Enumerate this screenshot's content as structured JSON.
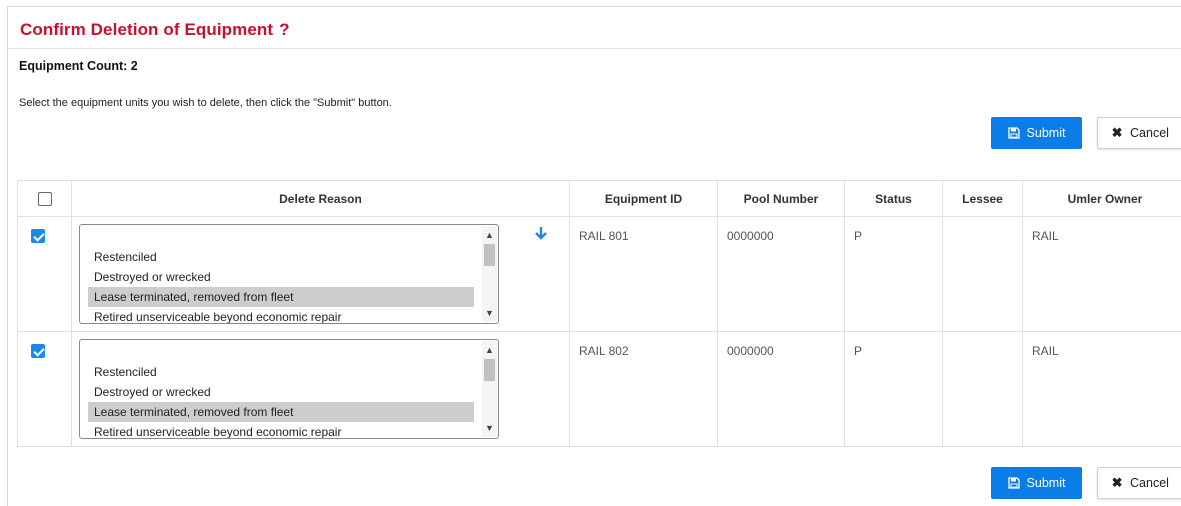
{
  "page": {
    "title": "Confirm Deletion of Equipment",
    "help_icon": "question-mark-icon",
    "count_text": "Equipment Count: 2",
    "instructions": "Select the equipment units you wish to delete, then click the \"Submit\" button."
  },
  "buttons": {
    "submit_label": "Submit",
    "cancel_label": "Cancel",
    "submit_icon": "floppy-disk-icon",
    "cancel_icon": "x-icon"
  },
  "colors": {
    "title": "#c8102e",
    "primary": "#0a7de8",
    "checkbox": "#1e88e5"
  },
  "table": {
    "headers": [
      "",
      "Delete Reason",
      "Equipment ID",
      "Pool Number",
      "Status",
      "Lessee",
      "Umler Owner"
    ],
    "reason_options": [
      "Restenciled",
      "Destroyed or wrecked",
      "Lease terminated, removed from fleet",
      "Retired unserviceable beyond economic repair"
    ],
    "rows": [
      {
        "checked": true,
        "selected_reason": "Lease terminated, removed from fleet",
        "equipment_id": "RAIL 801",
        "pool_number": "0000000",
        "status": "P",
        "lessee": "",
        "umler_owner": "RAIL"
      },
      {
        "checked": true,
        "selected_reason": "Lease terminated, removed from fleet",
        "equipment_id": "RAIL 802",
        "pool_number": "0000000",
        "status": "P",
        "lessee": "",
        "umler_owner": "RAIL"
      }
    ]
  }
}
